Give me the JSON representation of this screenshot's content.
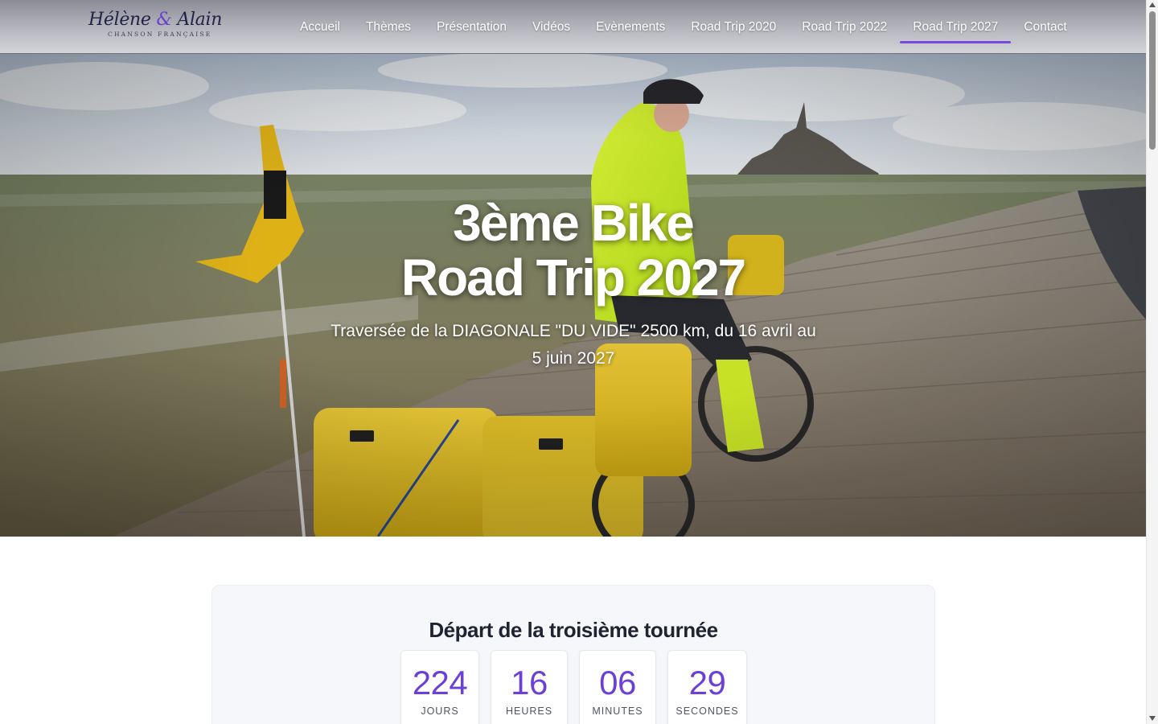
{
  "header": {
    "logo_name_1": "Hélène",
    "logo_amp": "&",
    "logo_name_2": "Alain",
    "logo_tagline": "CHANSON FRANÇAISE"
  },
  "nav": {
    "items": [
      {
        "label": "Accueil"
      },
      {
        "label": "Thèmes"
      },
      {
        "label": "Présentation"
      },
      {
        "label": "Vidéos"
      },
      {
        "label": "Evènements"
      },
      {
        "label": "Road Trip 2020"
      },
      {
        "label": "Road Trip 2022"
      },
      {
        "label": "Road Trip 2027"
      },
      {
        "label": "Contact"
      }
    ],
    "active": "Road Trip 2027"
  },
  "hero": {
    "title_line1": "3ème Bike",
    "title_line2": "Road Trip 2027",
    "subtitle": "Traversée de la DIAGONALE \"DU VIDE\" 2500 km, du 16 avril au 5 juin 2027"
  },
  "countdown": {
    "title": "Départ de la troisième tournée",
    "units": [
      {
        "value": "224",
        "label": "JOURS"
      },
      {
        "value": "16",
        "label": "HEURES"
      },
      {
        "value": "06",
        "label": "MINUTES"
      },
      {
        "value": "29",
        "label": "SECONDES"
      }
    ]
  },
  "colors": {
    "accent": "#6c3fd6",
    "nav_underline": "#7a48e0",
    "logo_text": "#23224a"
  }
}
